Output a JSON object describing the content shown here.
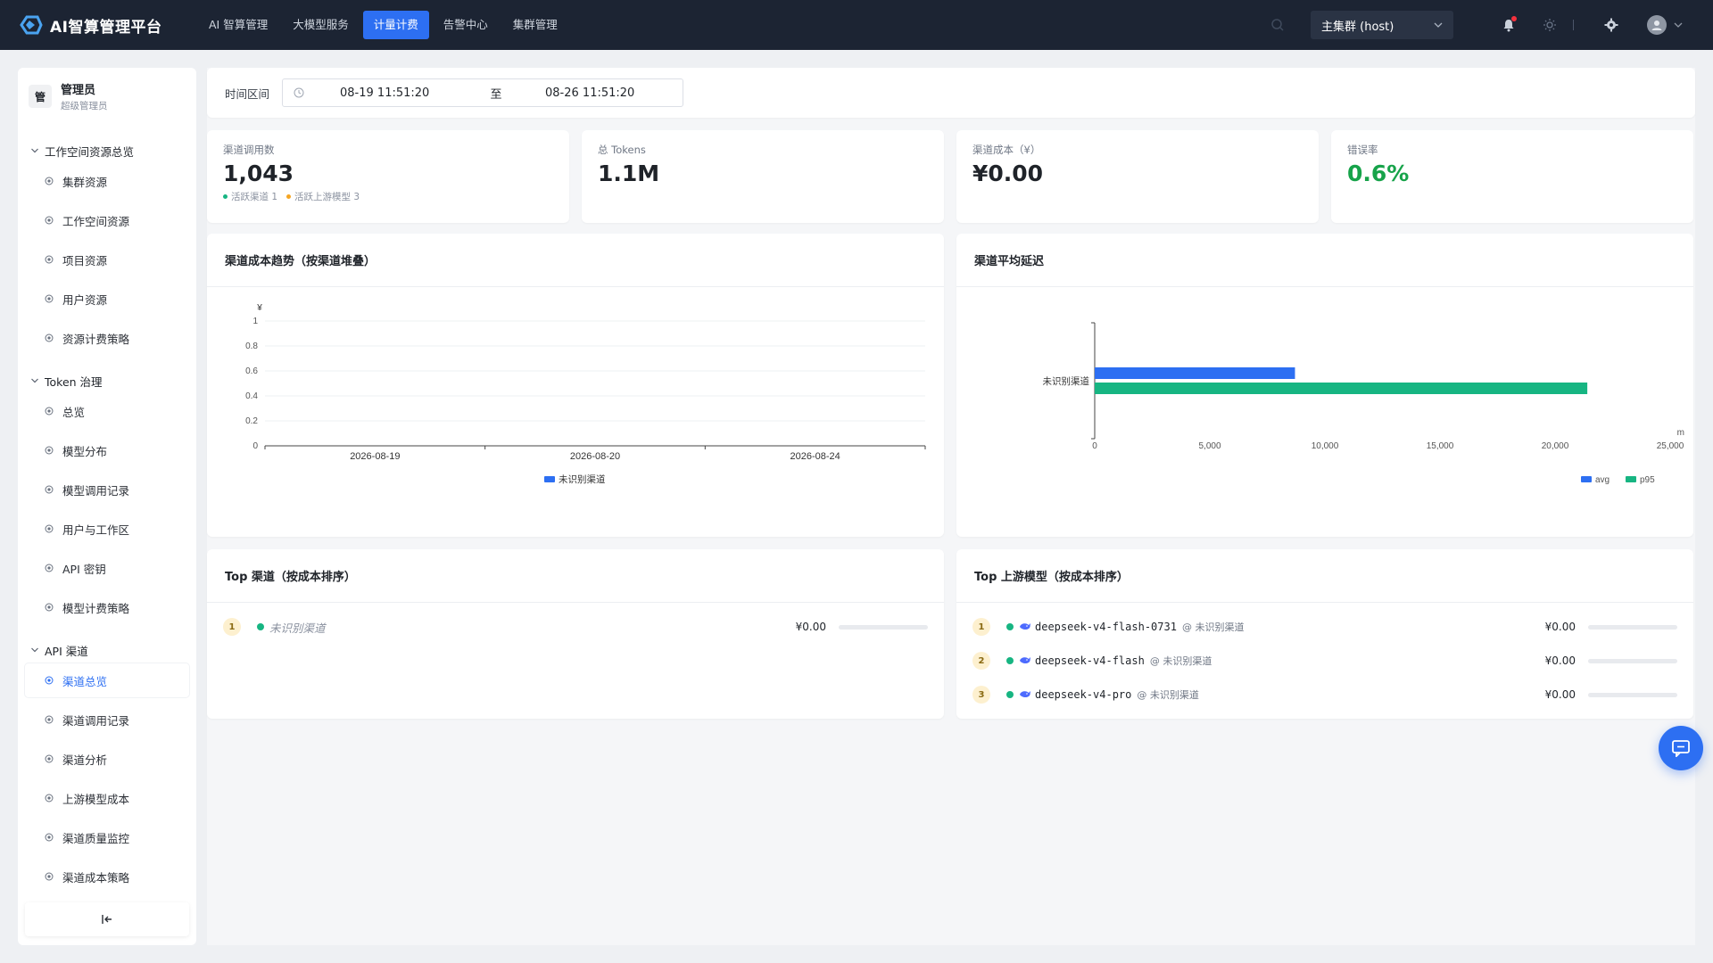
{
  "app": {
    "title": "AI智算管理平台"
  },
  "nav": {
    "items": [
      {
        "label": "AI 智算管理",
        "active": false
      },
      {
        "label": "大模型服务",
        "active": false
      },
      {
        "label": "计量计费",
        "active": true
      },
      {
        "label": "告警中心",
        "active": false
      },
      {
        "label": "集群管理",
        "active": false
      }
    ]
  },
  "topright": {
    "cluster": "主集群 (host)"
  },
  "user": {
    "badge": "管",
    "name": "管理员",
    "role": "超级管理员"
  },
  "sidebar": {
    "groups": [
      {
        "title": "工作空间资源总览",
        "items": [
          "集群资源",
          "工作空间资源",
          "项目资源",
          "用户资源",
          "资源计费策略"
        ]
      },
      {
        "title": "Token 治理",
        "items": [
          "总览",
          "模型分布",
          "模型调用记录",
          "用户与工作区",
          "API 密钥",
          "模型计费策略"
        ]
      },
      {
        "title": "API 渠道",
        "items": [
          "渠道总览",
          "渠道调用记录",
          "渠道分析",
          "上游模型成本",
          "渠道质量监控",
          "渠道成本策略"
        ]
      }
    ],
    "active_item": "渠道总览"
  },
  "filter": {
    "label": "时间区间",
    "start": "08-19 11:51:20",
    "separator": "至",
    "end": "08-26 11:51:20"
  },
  "kpis": [
    {
      "label": "渠道调用数",
      "value": "1,043",
      "sub": [
        {
          "text": "活跃渠道 1",
          "color": "#17b582"
        },
        {
          "text": "活跃上游模型 3",
          "color": "#f5a623"
        }
      ]
    },
    {
      "label": "总 Tokens",
      "value": "1.1M"
    },
    {
      "label": "渠道成本（¥）",
      "value": "¥0.00"
    },
    {
      "label": "错误率",
      "value": "0.6%",
      "color": "#17a34a"
    }
  ],
  "panels": {
    "cost_trend": {
      "title": "渠道成本趋势（按渠道堆叠）"
    },
    "latency": {
      "title": "渠道平均延迟"
    },
    "top_channels": {
      "title": "Top 渠道（按成本排序）",
      "rows": [
        {
          "rank": "1",
          "name": "未识别渠道",
          "value": "¥0.00"
        }
      ]
    },
    "top_models": {
      "title": "Top 上游模型（按成本排序）",
      "rows": [
        {
          "rank": "1",
          "model": "deepseek-v4-flash-0731",
          "channel": "@ 未识别渠道",
          "value": "¥0.00"
        },
        {
          "rank": "2",
          "model": "deepseek-v4-flash",
          "channel": "@ 未识别渠道",
          "value": "¥0.00"
        },
        {
          "rank": "3",
          "model": "deepseek-v4-pro",
          "channel": "@ 未识别渠道",
          "value": "¥0.00"
        }
      ]
    }
  },
  "chart_data": [
    {
      "type": "line",
      "title": "渠道成本趋势（按渠道堆叠）",
      "ylabel": "¥",
      "xlabel": "",
      "x": [
        "2026-08-19",
        "2026-08-20",
        "2026-08-24"
      ],
      "series": [
        {
          "name": "未识别渠道",
          "values": []
        }
      ],
      "ylim": [
        0,
        1
      ],
      "yticks": [
        "0",
        "0.2",
        "0.4",
        "0.6",
        "0.8",
        "1"
      ],
      "colors": [
        "#2d6ff2"
      ],
      "grid": true,
      "legend": "bottom"
    },
    {
      "type": "bar",
      "orientation": "horizontal",
      "title": "渠道平均延迟",
      "categories": [
        "未识别渠道"
      ],
      "series": [
        {
          "name": "avg",
          "values": [
            8700
          ],
          "color": "#2d6ff2"
        },
        {
          "name": "p95",
          "values": [
            21400
          ],
          "color": "#17b582"
        }
      ],
      "xlabel": "m",
      "xlim": [
        0,
        25000
      ],
      "xticks": [
        "0",
        "5,000",
        "10,000",
        "15,000",
        "20,000",
        "25,000"
      ],
      "legend": "bottom-right"
    }
  ]
}
